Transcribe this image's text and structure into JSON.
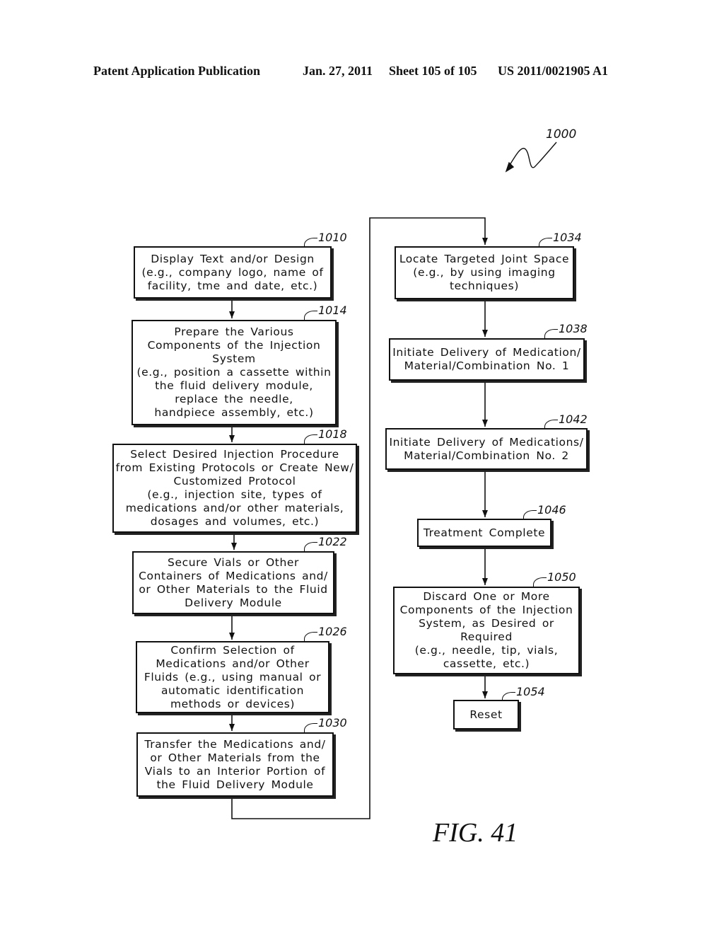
{
  "header": {
    "publication": "Patent Application Publication",
    "date": "Jan. 27, 2011",
    "sheet": "Sheet 105 of 105",
    "number": "US 2011/0021905 A1"
  },
  "figure": {
    "ref": "1000",
    "label": "FIG. 41"
  },
  "steps": [
    {
      "ref": "1010",
      "lines": [
        "Display Text and/or Design",
        "(e.g., company logo, name of",
        "facility, tme and date, etc.)"
      ]
    },
    {
      "ref": "1014",
      "lines": [
        "Prepare the Various",
        "Components of the Injection",
        "System",
        "(e.g., position a cassette within",
        "the fluid delivery module,",
        "replace the needle,",
        "handpiece assembly, etc.)"
      ]
    },
    {
      "ref": "1018",
      "lines": [
        "Select Desired Injection Procedure",
        "from Existing Protocols or Create New/",
        "Customized Protocol",
        "(e.g., injection site, types of",
        "medications and/or other materials,",
        "dosages and volumes, etc.)"
      ]
    },
    {
      "ref": "1022",
      "lines": [
        "Secure Vials or Other",
        "Containers of Medications and/",
        "or Other Materials to the Fluid",
        "Delivery Module"
      ]
    },
    {
      "ref": "1026",
      "lines": [
        "Confirm Selection of",
        "Medications and/or Other",
        "Fluids (e.g., using manual or",
        "automatic identification",
        "methods or devices)"
      ]
    },
    {
      "ref": "1030",
      "lines": [
        "Transfer the Medications and/",
        "or Other Materials from the",
        "Vials to an Interior Portion of",
        "the Fluid Delivery Module"
      ]
    },
    {
      "ref": "1034",
      "lines": [
        "Locate Targeted Joint Space",
        "(e.g., by using imaging",
        "techniques)"
      ]
    },
    {
      "ref": "1038",
      "lines": [
        "Initiate Delivery of Medication/",
        "Material/Combination No. 1"
      ]
    },
    {
      "ref": "1042",
      "lines": [
        "Initiate Delivery of Medications/",
        "Material/Combination No. 2"
      ]
    },
    {
      "ref": "1046",
      "lines": [
        "Treatment Complete"
      ]
    },
    {
      "ref": "1050",
      "lines": [
        "Discard One or More",
        "Components of the Injection",
        "System, as Desired or",
        "Required",
        "(e.g., needle, tip, vials,",
        "cassette, etc.)"
      ]
    },
    {
      "ref": "1054",
      "lines": [
        "Reset"
      ]
    }
  ]
}
